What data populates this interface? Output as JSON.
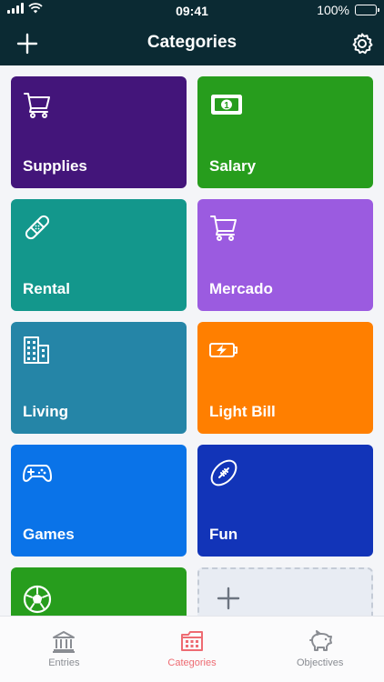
{
  "status_bar": {
    "time": "09:41",
    "battery_text": "100%",
    "icons": [
      "signal-icon",
      "wifi-icon",
      "battery-icon"
    ]
  },
  "header": {
    "title": "Categories",
    "add_icon": "plus-icon",
    "settings_icon": "gear-icon",
    "background": "#0b2a33"
  },
  "categories": [
    {
      "label": "Supplies",
      "icon": "shopping-cart-icon",
      "color": "#43157a"
    },
    {
      "label": "Salary",
      "icon": "banknote-icon",
      "color": "#279d1d"
    },
    {
      "label": "Rental",
      "icon": "bandage-icon",
      "color": "#13978c"
    },
    {
      "label": "Mercado",
      "icon": "shopping-cart-icon",
      "color": "#9b5be0"
    },
    {
      "label": "Living",
      "icon": "buildings-icon",
      "color": "#2585a7"
    },
    {
      "label": "Light Bill",
      "icon": "battery-charging-icon",
      "color": "#ff7f00"
    },
    {
      "label": "Games",
      "icon": "gamepad-icon",
      "color": "#0a73e8"
    },
    {
      "label": "Fun",
      "icon": "football-icon",
      "color": "#1234b8"
    },
    {
      "label": "",
      "icon": "soccer-ball-icon",
      "color": "#279d1d"
    }
  ],
  "add_category_tile": {
    "icon": "plus-icon"
  },
  "tab_bar": {
    "active_color": "#ee6b72",
    "tabs": [
      {
        "label": "Entries",
        "icon": "bank-icon",
        "active": false
      },
      {
        "label": "Categories",
        "icon": "calendar-grid-icon",
        "active": true
      },
      {
        "label": "Objectives",
        "icon": "piggy-bank-icon",
        "active": false
      }
    ]
  }
}
